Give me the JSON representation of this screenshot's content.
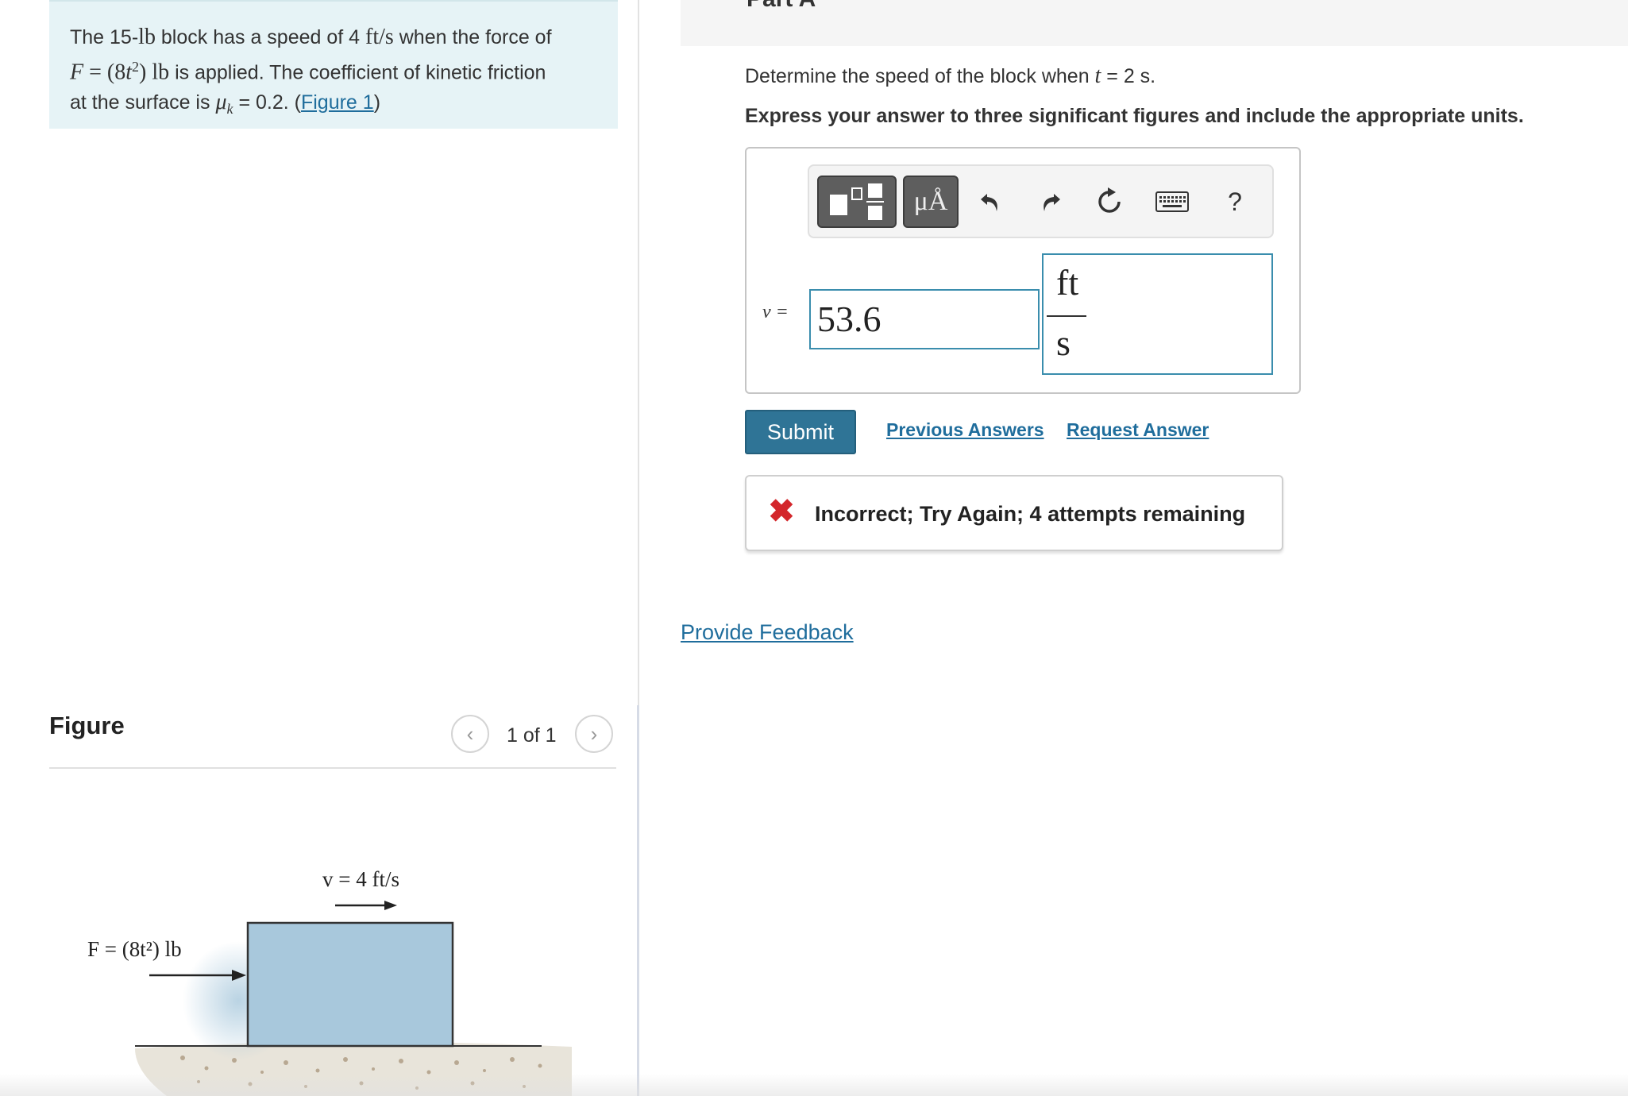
{
  "problem": {
    "text_1": "The 15-",
    "mass_unit": "lb",
    "text_2": " block has a speed of 4 ",
    "speed_unit": "ft/s",
    "text_3": " when the force of",
    "force_lhs": "F",
    "force_eq": " = (8",
    "force_var": "t",
    "force_exp": "2",
    "force_close": ") lb",
    "text_4": " is applied. The coefficient of kinetic friction",
    "text_5": "at the surface is ",
    "mu": "μ",
    "mu_sub": "k",
    "text_6": " = 0.2. (",
    "figure_link": "Figure 1",
    "text_7": ")"
  },
  "figure": {
    "heading": "Figure",
    "counter": "1 of 1",
    "prev_icon": "chevron-left-icon",
    "next_icon": "chevron-right-icon",
    "velocity_label": "v = 4 ft/s",
    "force_label": "F = (8t²) lb"
  },
  "part": {
    "title": "Part A",
    "question_a": "Determine the speed of the block when ",
    "question_var": "t",
    "question_b": " = 2 s.",
    "instruction": "Express your answer to three significant figures and include the appropriate units."
  },
  "toolbar": {
    "templates_icon": "templates-icon",
    "units_label": "μÅ",
    "undo_icon": "undo-icon",
    "redo_icon": "redo-icon",
    "reset_icon": "reset-icon",
    "keyboard_icon": "keyboard-icon",
    "help_label": "?"
  },
  "answer": {
    "variable_label": "v =",
    "value": "53.6",
    "unit_numerator": "ft",
    "unit_denominator": "s"
  },
  "actions": {
    "submit": "Submit",
    "previous_answers": "Previous Answers",
    "request_answer": "Request Answer"
  },
  "feedback": {
    "message": "Incorrect; Try Again; 4 attempts remaining",
    "status_color": "#d3262b"
  },
  "footer": {
    "provide_feedback": "Provide Feedback"
  },
  "colors": {
    "accent": "#2f7496",
    "link": "#1f6d9c",
    "problem_bg": "#e6f3f6",
    "block_fill": "#a8c8dc"
  }
}
